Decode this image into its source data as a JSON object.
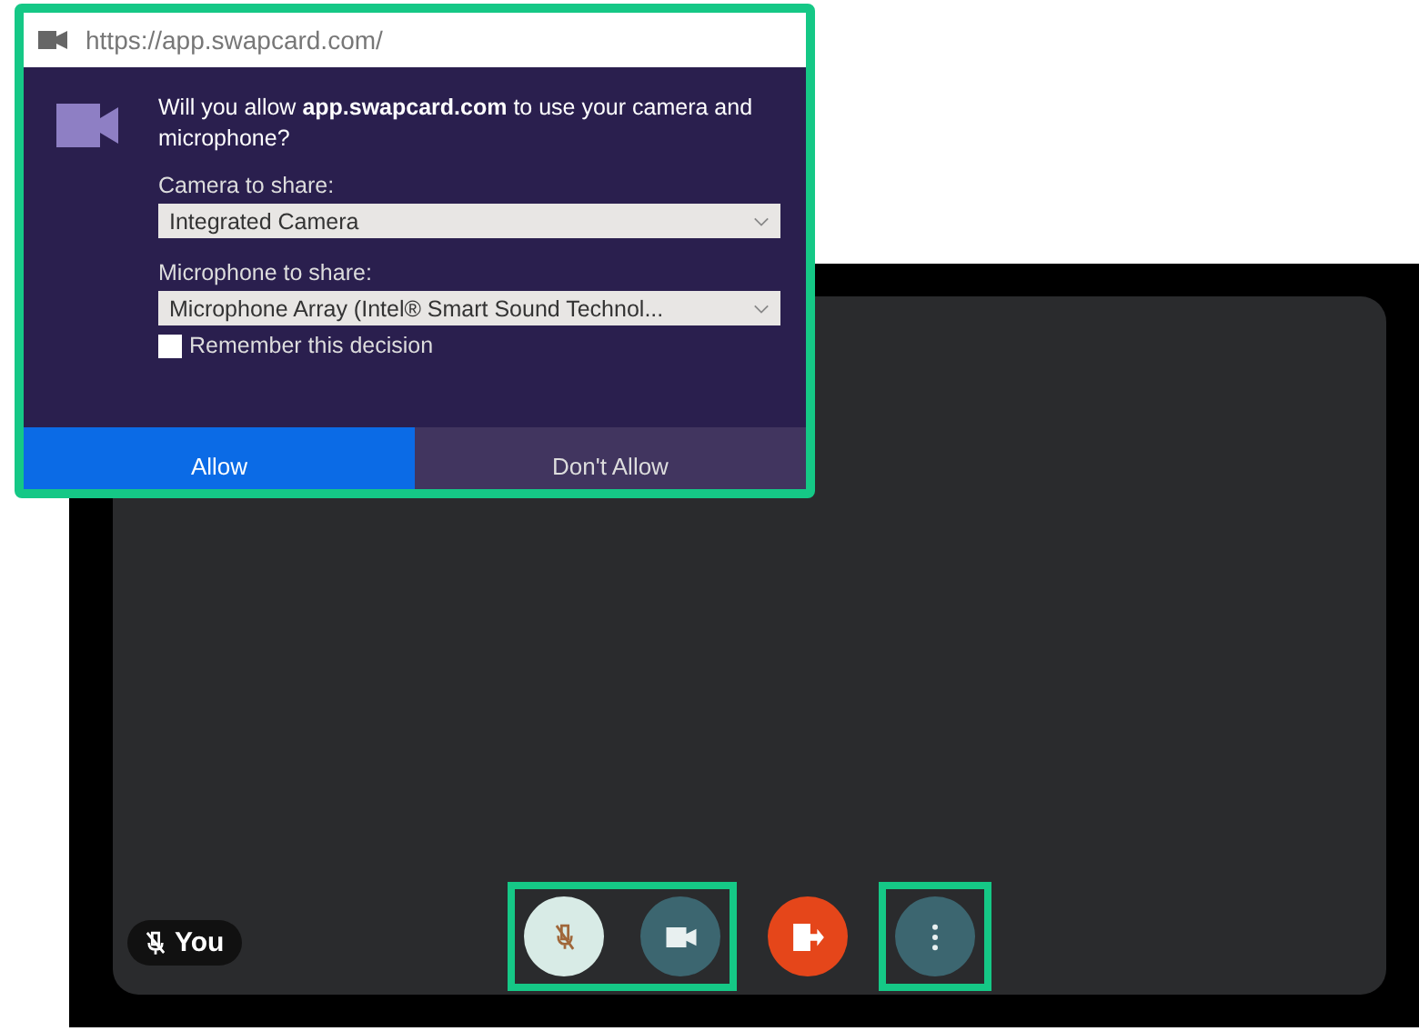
{
  "address_bar": {
    "url": "https://app.swapcard.com/"
  },
  "permission_dialog": {
    "message": "Will you allow **app.swapcard.com** to use your camera and microphone?",
    "camera_label": "Camera to share:",
    "camera_select": "Integrated Camera",
    "microphone_label": "Microphone to share:",
    "microphone_select": "Microphone Array (Intel® Smart Sound Technol...",
    "remember": {
      "label": "Remember this decision",
      "checked": false
    },
    "buttons": [
      {
        "label": "Allow",
        "kind": "primary"
      },
      {
        "label": "Don't Allow",
        "kind": "secondary"
      }
    ]
  },
  "video": {
    "participant": "You",
    "muted": true,
    "controls": [
      {
        "kind": "mic",
        "muted": true,
        "highlighted": true
      },
      {
        "kind": "camera",
        "highlighted": true
      },
      {
        "kind": "leave"
      },
      {
        "kind": "more",
        "highlighted": true
      }
    ]
  }
}
